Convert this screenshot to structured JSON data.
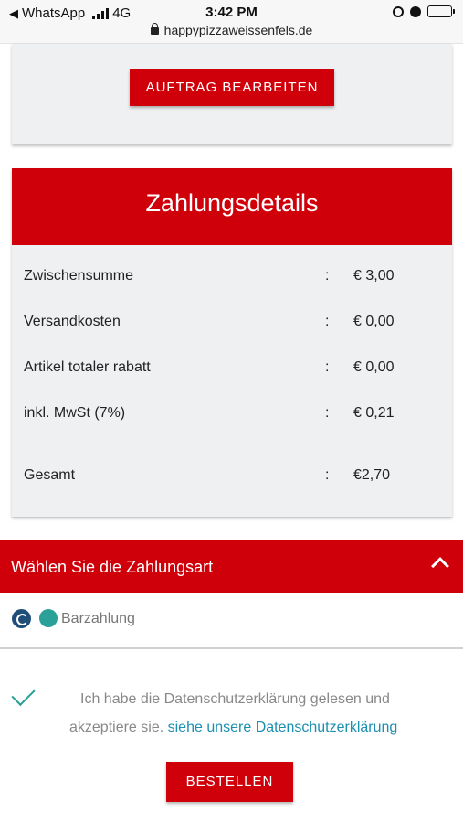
{
  "status_bar": {
    "back_app": "WhatsApp",
    "network": "4G",
    "time": "3:42 PM",
    "url": "happypizzaweissenfels.de"
  },
  "order": {
    "edit_button": "AUFTRAG BEARBEITEN"
  },
  "payment_details": {
    "title": "Zahlungsdetails",
    "rows": [
      {
        "label": "Zwischensumme",
        "colon": ":",
        "value": "€ 3,00"
      },
      {
        "label": "Versandkosten",
        "colon": ":",
        "value": "€ 0,00"
      },
      {
        "label": "Artikel totaler rabatt",
        "colon": ":",
        "value": "€ 0,00"
      },
      {
        "label": "inkl. MwSt (7%)",
        "colon": ":",
        "value": "€ 0,21"
      },
      {
        "label": "Gesamt",
        "colon": ":",
        "value": "€2,70"
      }
    ]
  },
  "payment_method": {
    "title": "Wählen Sie die Zahlungsart",
    "option_label": "Barzahlung"
  },
  "consent": {
    "line1": "Ich habe die Datenschutzerklärung gelesen und",
    "line2": "akzeptiere sie.",
    "link": "siehe unsere Datenschutzerklärung"
  },
  "order_button": "BESTELLEN",
  "colors": {
    "brand_red": "#d0000a",
    "accent_teal": "#2aa198",
    "link_blue": "#1a8fb0"
  }
}
